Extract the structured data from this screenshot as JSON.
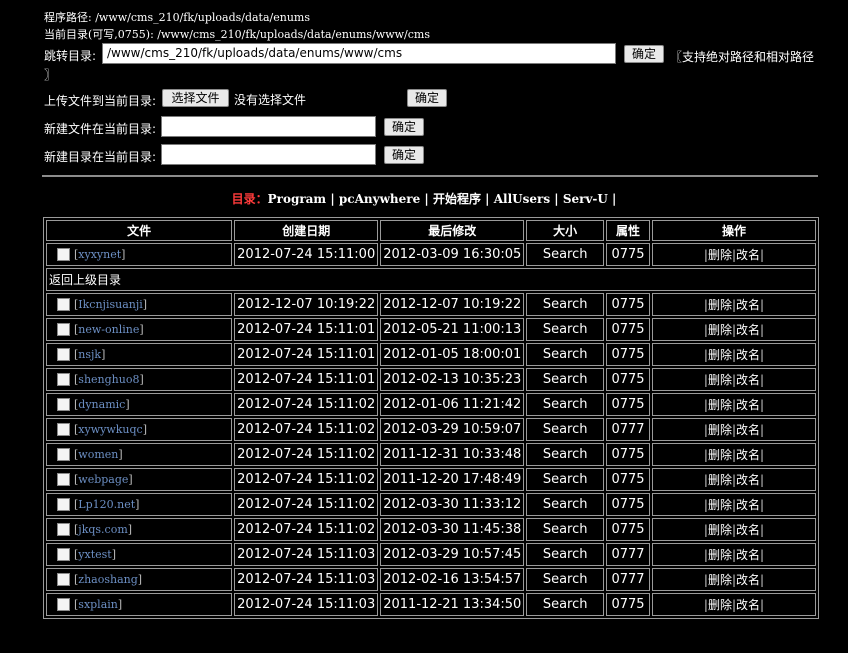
{
  "header": {
    "program_path": "程序路径: /www/cms_210/fk/uploads/data/enums",
    "current_dir": "当前目录(可写,0755): /www/cms_210/fk/uploads/data/enums/www/cms"
  },
  "jump": {
    "label": "跳转目录:",
    "value": "/www/cms_210/fk/uploads/data/enums/www/cms",
    "button": "确定",
    "note": "〖支持绝对路径和相对路径",
    "note_tail": "〗"
  },
  "upload": {
    "label": "上传文件到当前目录:",
    "choose_button": "选择文件",
    "no_file": "没有选择文件",
    "button": "确定"
  },
  "newfile": {
    "label": "新建文件在当前目录:",
    "value": "",
    "button": "确定"
  },
  "newdir": {
    "label": "新建目录在当前目录:",
    "value": "",
    "button": "确定"
  },
  "nav": {
    "title": "目录：",
    "links": [
      "Program",
      "pcAnywhere",
      "开始程序",
      "AllUsers",
      "Serv-U"
    ]
  },
  "table": {
    "headers": [
      "文件",
      "创建日期",
      "最后修改",
      "大小",
      "属性",
      "操作"
    ],
    "parent_dir": "返回上级目录",
    "ops": {
      "delete": "删除",
      "rename": "改名"
    },
    "first_row": {
      "name": "xyxynet",
      "created": "2012-07-24 15:11:00",
      "modified": "2012-03-09 16:30:05",
      "size": "Search",
      "perm": "0775"
    },
    "rows": [
      {
        "name": "Ikcnjisuanji",
        "created": "2012-12-07 10:19:22",
        "modified": "2012-12-07 10:19:22",
        "size": "Search",
        "perm": "0775"
      },
      {
        "name": "new-online",
        "created": "2012-07-24 15:11:01",
        "modified": "2012-05-21 11:00:13",
        "size": "Search",
        "perm": "0775"
      },
      {
        "name": "nsjk",
        "created": "2012-07-24 15:11:01",
        "modified": "2012-01-05 18:00:01",
        "size": "Search",
        "perm": "0775"
      },
      {
        "name": "shenghuo8",
        "created": "2012-07-24 15:11:01",
        "modified": "2012-02-13 10:35:23",
        "size": "Search",
        "perm": "0775"
      },
      {
        "name": "dynamic",
        "created": "2012-07-24 15:11:02",
        "modified": "2012-01-06 11:21:42",
        "size": "Search",
        "perm": "0775"
      },
      {
        "name": "xywywkuqc",
        "created": "2012-07-24 15:11:02",
        "modified": "2012-03-29 10:59:07",
        "size": "Search",
        "perm": "0777"
      },
      {
        "name": "women",
        "created": "2012-07-24 15:11:02",
        "modified": "2011-12-31 10:33:48",
        "size": "Search",
        "perm": "0775"
      },
      {
        "name": "webpage",
        "created": "2012-07-24 15:11:02",
        "modified": "2011-12-20 17:48:49",
        "size": "Search",
        "perm": "0775"
      },
      {
        "name": "Lp120.net",
        "created": "2012-07-24 15:11:02",
        "modified": "2012-03-30 11:33:12",
        "size": "Search",
        "perm": "0775"
      },
      {
        "name": "jkqs.com",
        "created": "2012-07-24 15:11:02",
        "modified": "2012-03-30 11:45:38",
        "size": "Search",
        "perm": "0775"
      },
      {
        "name": "yxtest",
        "created": "2012-07-24 15:11:03",
        "modified": "2012-03-29 10:57:45",
        "size": "Search",
        "perm": "0777"
      },
      {
        "name": "zhaoshang",
        "created": "2012-07-24 15:11:03",
        "modified": "2012-02-16 13:54:57",
        "size": "Search",
        "perm": "0777"
      },
      {
        "name": "sxplain",
        "created": "2012-07-24 15:11:03",
        "modified": "2011-12-21 13:34:50",
        "size": "Search",
        "perm": "0775"
      }
    ]
  }
}
